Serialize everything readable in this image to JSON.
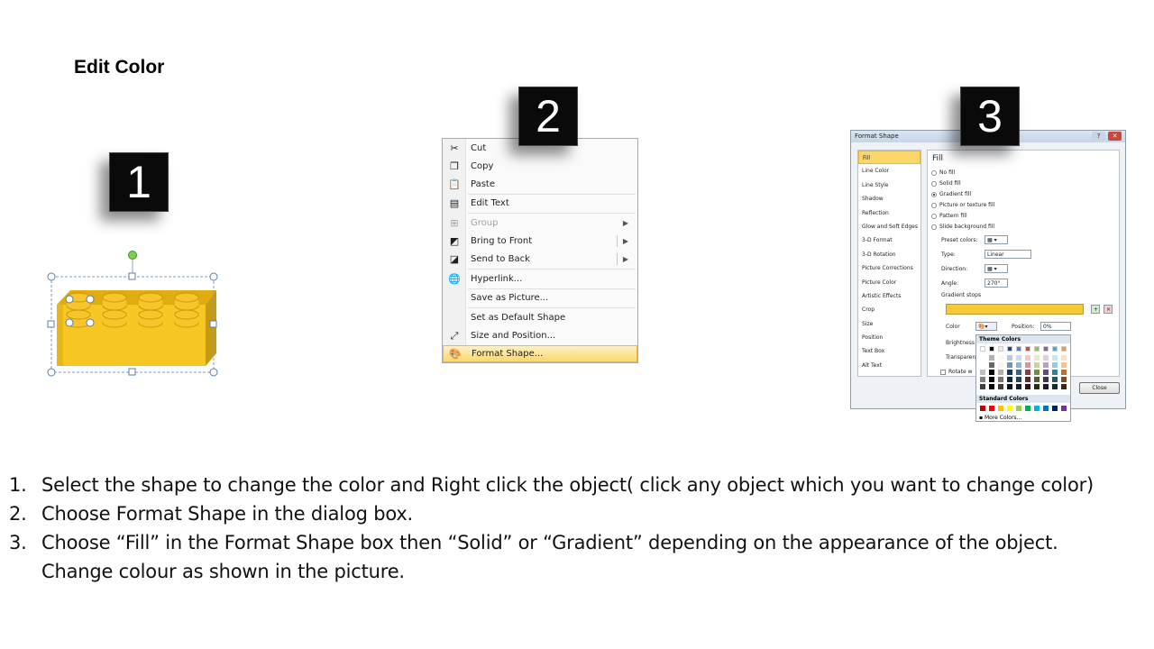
{
  "slide": {
    "title": "Edit Color",
    "badges": [
      "1",
      "2",
      "3"
    ]
  },
  "context_menu": {
    "items": [
      {
        "label": "Cut",
        "icon": "scissors-icon",
        "disabled": false
      },
      {
        "label": "Copy",
        "icon": "copy-icon",
        "disabled": false
      },
      {
        "label": "Paste",
        "icon": "paste-icon",
        "disabled": false
      },
      {
        "label": "Edit Text",
        "icon": "edit-text-icon",
        "disabled": false
      },
      {
        "label": "Group",
        "icon": "group-icon",
        "disabled": true
      },
      {
        "label": "Bring to Front",
        "icon": "bring-front-icon",
        "disabled": false
      },
      {
        "label": "Send to Back",
        "icon": "send-back-icon",
        "disabled": false
      },
      {
        "label": "Hyperlink...",
        "icon": "hyperlink-icon",
        "disabled": false
      },
      {
        "label": "Save as Picture...",
        "icon": "",
        "disabled": false
      },
      {
        "label": "Set as Default Shape",
        "icon": "",
        "disabled": false
      },
      {
        "label": "Size and Position...",
        "icon": "size-icon",
        "disabled": false
      },
      {
        "label": "Format Shape...",
        "icon": "format-shape-icon",
        "disabled": false
      }
    ]
  },
  "format_dialog": {
    "title": "Format Shape",
    "nav": [
      "Fill",
      "Line Color",
      "Line Style",
      "Shadow",
      "Reflection",
      "Glow and Soft Edges",
      "3-D Format",
      "3-D Rotation",
      "Picture Corrections",
      "Picture Color",
      "Artistic Effects",
      "Crop",
      "Size",
      "Position",
      "Text Box",
      "Alt Text"
    ],
    "section_title": "Fill",
    "options": [
      "No fill",
      "Solid fill",
      "Gradient fill",
      "Picture or texture fill",
      "Pattern fill",
      "Slide background fill"
    ],
    "selected_option": "Gradient fill",
    "labels": {
      "preset": "Preset colors:",
      "type": "Type:",
      "type_value": "Linear",
      "direction": "Direction:",
      "angle": "Angle:",
      "angle_value": "270°",
      "stops": "Gradient stops",
      "color": "Color",
      "position": "Position:",
      "position_value": "0%",
      "brightness": "Brightness",
      "transparency": "Transparen",
      "rotate": "Rotate w"
    },
    "close_label": "Close",
    "palette": {
      "theme_title": "Theme Colors",
      "standard_title": "Standard Colors",
      "more": "More Colors..."
    }
  },
  "colors": {
    "brick": "#f6c623",
    "highlight": "#fcd76b"
  },
  "instructions": [
    {
      "num": "1.",
      "text": "Select the shape to change the color and Right click the object( click any object which you want to change color)"
    },
    {
      "num": "2.",
      "text": "Choose Format Shape in the dialog box."
    },
    {
      "num": "3.",
      "text": "Choose “Fill” in the Format Shape box then “Solid” or “Gradient” depending on the appearance of the object."
    },
    {
      "num": "",
      "text": "Change colour as shown in the picture."
    }
  ]
}
